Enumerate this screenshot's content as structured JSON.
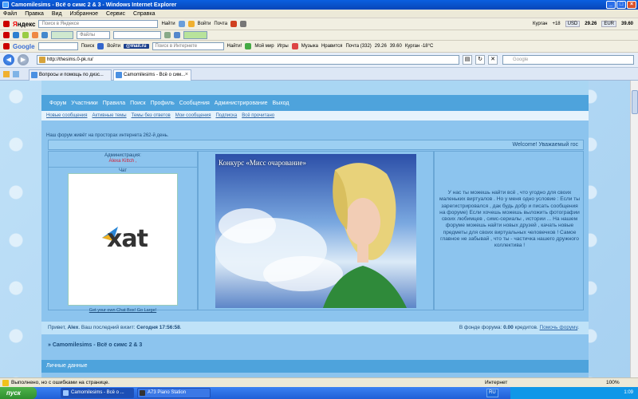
{
  "window": {
    "title": "Camomilesims - Всё о симс 2 & 3 - Windows Internet Explorer"
  },
  "menu": [
    "Файл",
    "Правка",
    "Вид",
    "Избранное",
    "Сервис",
    "Справка"
  ],
  "yandex_bar": {
    "search_placeholder": "Поиск в Яндексе",
    "find": "Найти",
    "login": "Войти",
    "mail": "Почта",
    "city": "Курган",
    "temp": "+18",
    "usd_label": "USD",
    "usd": "29.26",
    "eur_label": "EUR",
    "eur": "39.60"
  },
  "toolbar2": {
    "files_label": "Файлы"
  },
  "mailru_bar": {
    "google_logo": "Google",
    "search_btn": "Поиск",
    "login": "Войти",
    "mailru_logo": "@mail.ru",
    "search_placeholder": "Поиск в Интернете",
    "find": "Найти!",
    "my_world": "Мой мир",
    "games": "Игры",
    "music": "Музыка",
    "likes": "Нравится",
    "mail": "Почта (332)",
    "usd": "29.26",
    "eur": "39.60",
    "weather": "Курган -18°C"
  },
  "address": {
    "url": "http://thesims.0-pk.ru/",
    "search_placeholder": "Google"
  },
  "tabs": [
    {
      "label": "Вопросы и помощь по дизс..."
    },
    {
      "label": "Camomilesims - Всё о сим..."
    }
  ],
  "forum": {
    "nav_main": [
      "Форум",
      "Участники",
      "Правила",
      "Поиск",
      "Профиль",
      "Сообщения",
      "Администрирование",
      "Выход"
    ],
    "nav_sub": [
      "Новые сообщения",
      "Активные темы",
      "Темы без ответов",
      "Мои сообщения",
      "Подписка",
      "Всё прочитано"
    ],
    "age_line": "Наш форум живёт на просторах интернета 262-й день.",
    "welcome": "Welcome! Уважаемый гос",
    "admin_title": "Администрация:",
    "admin_name": "Alexa Kittch ,",
    "chat_label": "Чат",
    "xat_logo": "xat",
    "xat_links": "Get your own Chat Box!  Go Large!",
    "banner_title": "Конкурс «Мисс очарование»",
    "about": "У нас ты можешь найти всё , что угодно для своих маленьких виртуалов . Но у меня одно условие : Если ты зарегистрировался , дак будь добр и писать сообщения на форуме) Если хочешь можешь выложить фотографии своих любимцев , симс-сериалы , истории ... На нашем форуме можешь найти новых друзей , качать новые предметы для своих виртуальных человечков ! Самое главное не забывай , что ты - частичка нашего дружного коллектива !",
    "greeting": "Привет, ",
    "user": "Alex",
    "last_visit_label": ". Ваш последний визит: ",
    "last_visit": "Сегодня 17:56:58",
    "bank_prefix": "В фонде форума: ",
    "bank_value": "0.00",
    "bank_suffix": " кредитов. ",
    "bank_link": "Помочь форуму",
    "crumb": "» Camomilesims - Всё о симс 2 & 3",
    "section": "Личные данные"
  },
  "status": {
    "text": "Выполнено, но с ошибками на странице.",
    "zone": "Интернет",
    "zoom": "100%"
  },
  "taskbar": {
    "start": "пуск",
    "buttons": [
      "Camomilesims - Всё о ...",
      "A73 Piano Station"
    ],
    "lang": "RU",
    "clock": "1:09"
  }
}
